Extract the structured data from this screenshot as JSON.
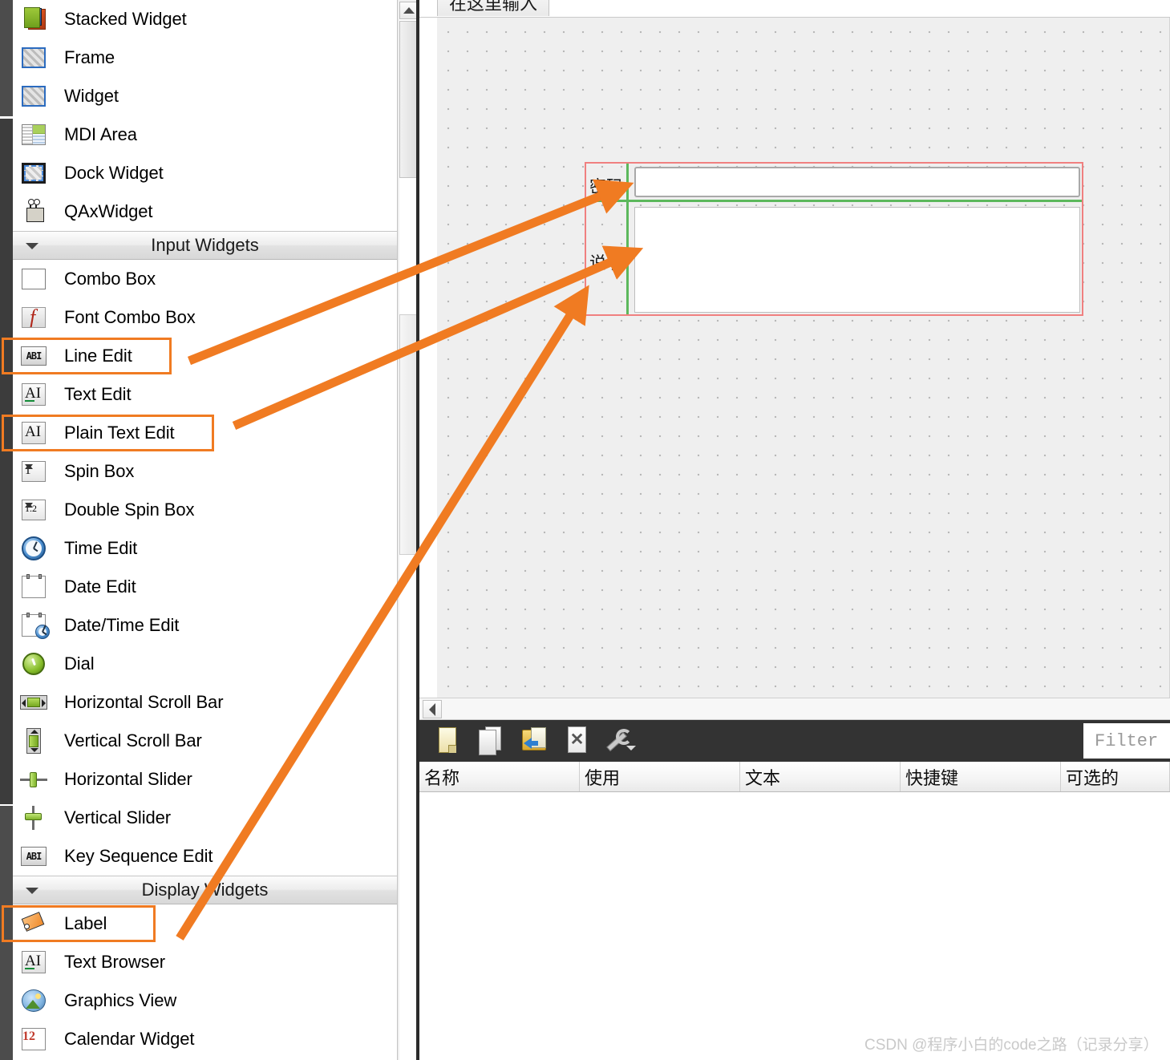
{
  "widget_box": {
    "groups": [
      {
        "items": [
          {
            "label": "Stacked Widget",
            "icon": "stacked-widget-icon",
            "highlighted": false
          },
          {
            "label": "Frame",
            "icon": "frame-icon",
            "highlighted": false
          },
          {
            "label": "Widget",
            "icon": "widget-icon",
            "highlighted": false
          },
          {
            "label": "MDI Area",
            "icon": "mdi-area-icon",
            "highlighted": false
          },
          {
            "label": "Dock Widget",
            "icon": "dock-widget-icon",
            "highlighted": false
          },
          {
            "label": "QAxWidget",
            "icon": "qax-widget-icon",
            "highlighted": false
          }
        ]
      },
      {
        "section": "Input Widgets",
        "items": [
          {
            "label": "Combo Box",
            "icon": "combo-box-icon",
            "highlighted": false
          },
          {
            "label": "Font Combo Box",
            "icon": "font-combo-box-icon",
            "highlighted": false
          },
          {
            "label": "Line Edit",
            "icon": "line-edit-icon",
            "highlighted": true
          },
          {
            "label": "Text Edit",
            "icon": "text-edit-icon",
            "highlighted": false
          },
          {
            "label": "Plain Text Edit",
            "icon": "plain-text-edit-icon",
            "highlighted": true
          },
          {
            "label": "Spin Box",
            "icon": "spin-box-icon",
            "highlighted": false
          },
          {
            "label": "Double Spin Box",
            "icon": "double-spin-box-icon",
            "highlighted": false
          },
          {
            "label": "Time Edit",
            "icon": "time-edit-icon",
            "highlighted": false
          },
          {
            "label": "Date Edit",
            "icon": "date-edit-icon",
            "highlighted": false
          },
          {
            "label": "Date/Time Edit",
            "icon": "date-time-edit-icon",
            "highlighted": false
          },
          {
            "label": "Dial",
            "icon": "dial-icon",
            "highlighted": false
          },
          {
            "label": "Horizontal Scroll Bar",
            "icon": "horizontal-scroll-bar-icon",
            "highlighted": false
          },
          {
            "label": "Vertical Scroll Bar",
            "icon": "vertical-scroll-bar-icon",
            "highlighted": false
          },
          {
            "label": "Horizontal Slider",
            "icon": "horizontal-slider-icon",
            "highlighted": false
          },
          {
            "label": "Vertical Slider",
            "icon": "vertical-slider-icon",
            "highlighted": false
          },
          {
            "label": "Key Sequence Edit",
            "icon": "key-sequence-edit-icon",
            "highlighted": false
          }
        ]
      },
      {
        "section": "Display Widgets",
        "items": [
          {
            "label": "Label",
            "icon": "label-icon",
            "highlighted": true
          },
          {
            "label": "Text Browser",
            "icon": "text-browser-icon",
            "highlighted": false
          },
          {
            "label": "Graphics View",
            "icon": "graphics-view-icon",
            "highlighted": false
          },
          {
            "label": "Calendar Widget",
            "icon": "calendar-widget-icon",
            "highlighted": false
          }
        ]
      }
    ]
  },
  "canvas": {
    "tab_label": "在这里输入",
    "form": {
      "password_label": "密码",
      "password_value": "",
      "description_label": "说明",
      "description_value": ""
    }
  },
  "action_editor": {
    "toolbar_icons": [
      "new-action-icon",
      "copy-action-icon",
      "open-save-action-icon",
      "delete-action-icon",
      "configure-wrench-icon"
    ],
    "filter_placeholder": "Filter",
    "columns": [
      "名称",
      "使用",
      "文本",
      "快捷键",
      "可选的"
    ]
  },
  "annotations": {
    "accent_color": "#f07b22",
    "arrows": [
      {
        "name": "arrow-line-edit-to-password-field"
      },
      {
        "name": "arrow-plain-text-edit-to-description-field"
      },
      {
        "name": "arrow-label-to-form-labels"
      }
    ]
  },
  "watermark": "CSDN @程序小白的code之路（记录分享）"
}
